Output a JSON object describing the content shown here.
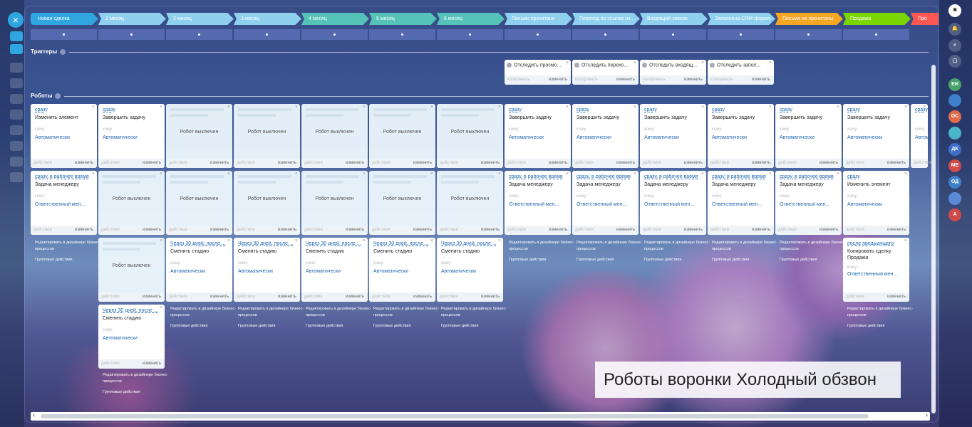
{
  "stages": [
    {
      "label": "Новая сделка",
      "color": "#2fa6e0"
    },
    {
      "label": "1 месяц",
      "color": "#8fd0ef"
    },
    {
      "label": "2 месяц",
      "color": "#8fd0ef"
    },
    {
      "label": "3 месяц",
      "color": "#8fd0ef"
    },
    {
      "label": "4 месяц",
      "color": "#56c3b8"
    },
    {
      "label": "5 месяц",
      "color": "#56c3b8"
    },
    {
      "label": "6 месяц",
      "color": "#56c3b8"
    },
    {
      "label": "Письмо прочитано",
      "color": "#8fd0ef"
    },
    {
      "label": "Переход по ссылке из ...",
      "color": "#8fd0ef"
    },
    {
      "label": "Входящий звонок",
      "color": "#8fd0ef"
    },
    {
      "label": "Заполнена CRM-форма",
      "color": "#8fd0ef"
    },
    {
      "label": "Письма не прочитаны",
      "color": "#f5a623"
    },
    {
      "label": "Продажа",
      "color": "#7bd500"
    },
    {
      "label": "Про",
      "color": "#ff5752"
    }
  ],
  "sections": {
    "triggers": "Триггеры",
    "robots": "Роботы"
  },
  "triggers": [
    {
      "title": "Отследить просмо..."
    },
    {
      "title": "Отследить перехо..."
    },
    {
      "title": "Отследить входящ..."
    },
    {
      "title": "Отследить запол..."
    }
  ],
  "common": {
    "copy": "копировать",
    "edit": "изменить",
    "actions": "действия",
    "to": "кому:",
    "off": "Робот выключен",
    "close": "×",
    "link_designer": "Редактировать в дизайнере бизнес-процессов",
    "link_group": "Групповые действия"
  },
  "robots": {
    "r1": [
      {
        "when": "сразу",
        "name": "Изменить элемент",
        "to": "Автоматически"
      },
      {
        "when": "сразу",
        "name": "Завершить задачу",
        "to": "Автоматически"
      },
      {
        "off": true
      },
      {
        "off": true
      },
      {
        "off": true
      },
      {
        "off": true
      },
      {
        "off": true
      },
      {
        "when": "сразу",
        "name": "Завершить задачу",
        "to": "Автоматически"
      },
      {
        "when": "сразу",
        "name": "Завершить задачу",
        "to": "Автоматически"
      },
      {
        "when": "сразу",
        "name": "Завершить задачу",
        "to": "Автоматически"
      },
      {
        "when": "сразу",
        "name": "Завершить задачу",
        "to": "Автоматически"
      },
      {
        "when": "сразу",
        "name": "Завершить задачу",
        "to": "Автоматически"
      },
      {
        "when": "сразу",
        "name": "Завершить задачу",
        "to": "Автоматически"
      },
      {
        "when": "сразу",
        "name": "",
        "to": "Автом"
      }
    ],
    "r2": [
      {
        "when": "сразу, в рабочее время",
        "name": "Задача менеджеру",
        "to": "Ответственный мен..."
      },
      {
        "off": true
      },
      {
        "off": true
      },
      {
        "off": true
      },
      {
        "off": true
      },
      {
        "off": true
      },
      {
        "off": true
      },
      {
        "when": "сразу, в рабочее время",
        "name": "Задача менеджеру",
        "to": "Ответственный мен..."
      },
      {
        "when": "сразу, в рабочее время",
        "name": "Задача менеджеру",
        "to": "Ответственный мен..."
      },
      {
        "when": "сразу, в рабочее время",
        "name": "Задача менеджеру",
        "to": "Ответственный мен..."
      },
      {
        "when": "сразу, в рабочее время",
        "name": "Задача менеджеру",
        "to": "Ответственный мен..."
      },
      {
        "when": "сразу, в рабочее время",
        "name": "Задача менеджеру",
        "to": "Ответственный мен..."
      },
      {
        "when": "сразу",
        "name": "Изменить элемент",
        "to": "Автоматически"
      }
    ],
    "r3": [
      {
        "off": true
      },
      {
        "when": "Через 30 дней, после ...",
        "name": "Сменить стадию",
        "to": "Автоматически"
      },
      {
        "when": "Через 30 дней, после ...",
        "name": "Сменить стадию",
        "to": "Автоматически"
      },
      {
        "when": "Через 30 дней, после ...",
        "name": "Сменить стадию",
        "to": "Автоматически"
      },
      {
        "when": "Через 30 дней, после ...",
        "name": "Сменить стадию",
        "to": "Автоматически"
      },
      {
        "when": "Через 30 дней, после ...",
        "name": "Сменить стадию",
        "to": "Автоматически"
      },
      {
        "when": "после предыдущего",
        "name": "Копировать сделку Продажи",
        "to": "Ответственный мен..."
      }
    ],
    "r4": {
      "when": "Через 30 дней, после ...",
      "name": "Сменить стадию",
      "to": "Автоматически"
    }
  },
  "right_sidebar": [
    "ЕИ",
    "",
    "ОС",
    "",
    "ДК",
    "МЕ",
    "ОД",
    "",
    "А"
  ],
  "caption": "Роботы воронки Холодный обзвон"
}
